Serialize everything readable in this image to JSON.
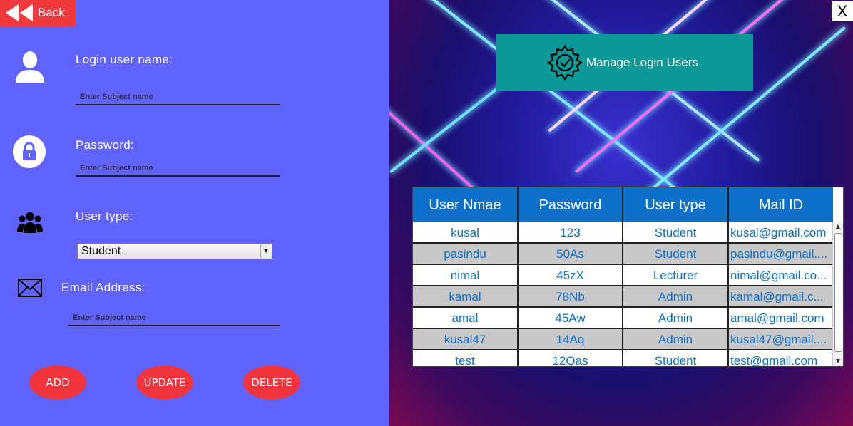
{
  "back_label": "Back",
  "close_label": "X",
  "form": {
    "username_label": "Login user name:",
    "username_placeholder": "Enter Subject name",
    "password_label": "Password:",
    "password_placeholder": "Enter Subject name",
    "usertype_label": "User type:",
    "usertype_value": "Student",
    "email_label": "Email Address:",
    "email_placeholder": "Enter Subject name"
  },
  "buttons": {
    "add": "ADD",
    "update": "UPDATE",
    "delete": "DELETE"
  },
  "manage_title": "Manage Login Users",
  "table": {
    "headers": [
      "User Nmae",
      "Password",
      "User type",
      "Mail ID"
    ],
    "rows": [
      [
        "kusal",
        "123",
        "Student",
        "kusal@gmail.com"
      ],
      [
        "pasindu",
        "50As",
        "Student",
        "pasindu@gmail...."
      ],
      [
        "nimal",
        "45zX",
        "Lecturer",
        "nimal@gmail.co..."
      ],
      [
        "kamal",
        "78Nb",
        "Admin",
        "kamal@gmail.c..."
      ],
      [
        "amal",
        "45Aw",
        "Admin",
        "amal@gmail.com"
      ],
      [
        "kusal47",
        "14Aq",
        "Admin",
        "kusal47@gmail...."
      ],
      [
        "test",
        "12Qas",
        "Student",
        "test@gmail.com"
      ]
    ]
  },
  "colors": {
    "left_panel": "#6163fe",
    "accent_red": "#f2353d",
    "header_blue": "#0d71c9",
    "teal": "#0b9a98"
  },
  "icons": [
    "rewind-icon",
    "user-icon",
    "lock-icon",
    "group-icon",
    "mail-icon",
    "gear-check-icon"
  ]
}
